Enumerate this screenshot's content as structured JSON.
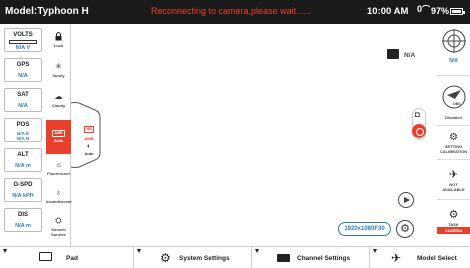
{
  "topbar": {
    "model": "Model:Typhoon H",
    "status": "Reconnecting to camera,please wait......",
    "time": "10:00 AM",
    "signal": "0",
    "battery": "97%",
    "battery_level": 0.97
  },
  "telemetry": [
    {
      "label": "VOLTS",
      "value": "N/A V"
    },
    {
      "label": "GPS",
      "value": "N/A"
    },
    {
      "label": "SAT",
      "value": "N/A"
    },
    {
      "label": "POS",
      "value": "N/A E\nN/A N"
    },
    {
      "label": "ALT",
      "value": "N/A m"
    },
    {
      "label": "G-SPD",
      "value": "N/A kPH"
    },
    {
      "label": "DIS",
      "value": "N/A m"
    }
  ],
  "white_balance": {
    "items": [
      {
        "label": "Lock",
        "icon": "lock-icon"
      },
      {
        "label": "Sunny",
        "icon": "sun-icon"
      },
      {
        "label": "Cloudy",
        "icon": "cloud-icon"
      },
      {
        "label": "Auto",
        "badge": "AWB",
        "icon": "awb-icon",
        "active": true
      },
      {
        "label": "Fluorescent",
        "icon": "fluorescent-icon"
      },
      {
        "label": "Incandescent",
        "icon": "incandescent-icon"
      },
      {
        "label": "Sunset/\nSunrise",
        "icon": "sunset-icon"
      }
    ],
    "flyout": {
      "awb_badge": "WB",
      "awb_label": "AWB",
      "auto_label": "Auto"
    }
  },
  "camera": {
    "mode_value": "N/A",
    "resolution": "1920x1080F30"
  },
  "rightpanel": {
    "gimbal_value": "N/A",
    "obs_label": "OBS",
    "obs_status": "Disabled",
    "setting_calibration": "SETTING\nCALIBRATION",
    "not_available": "NOT\nAVAILABLE",
    "task_label": "TASK",
    "task_sub": "CAMERA"
  },
  "bottombar": {
    "pad": "Pad",
    "system_settings": "System Settings",
    "channel_settings": "Channel Settings",
    "model_select": "Model Select"
  },
  "colors": {
    "accent": "#e8402a",
    "link": "#2a7ab8",
    "topbar_bg": "#1a1a1a"
  }
}
